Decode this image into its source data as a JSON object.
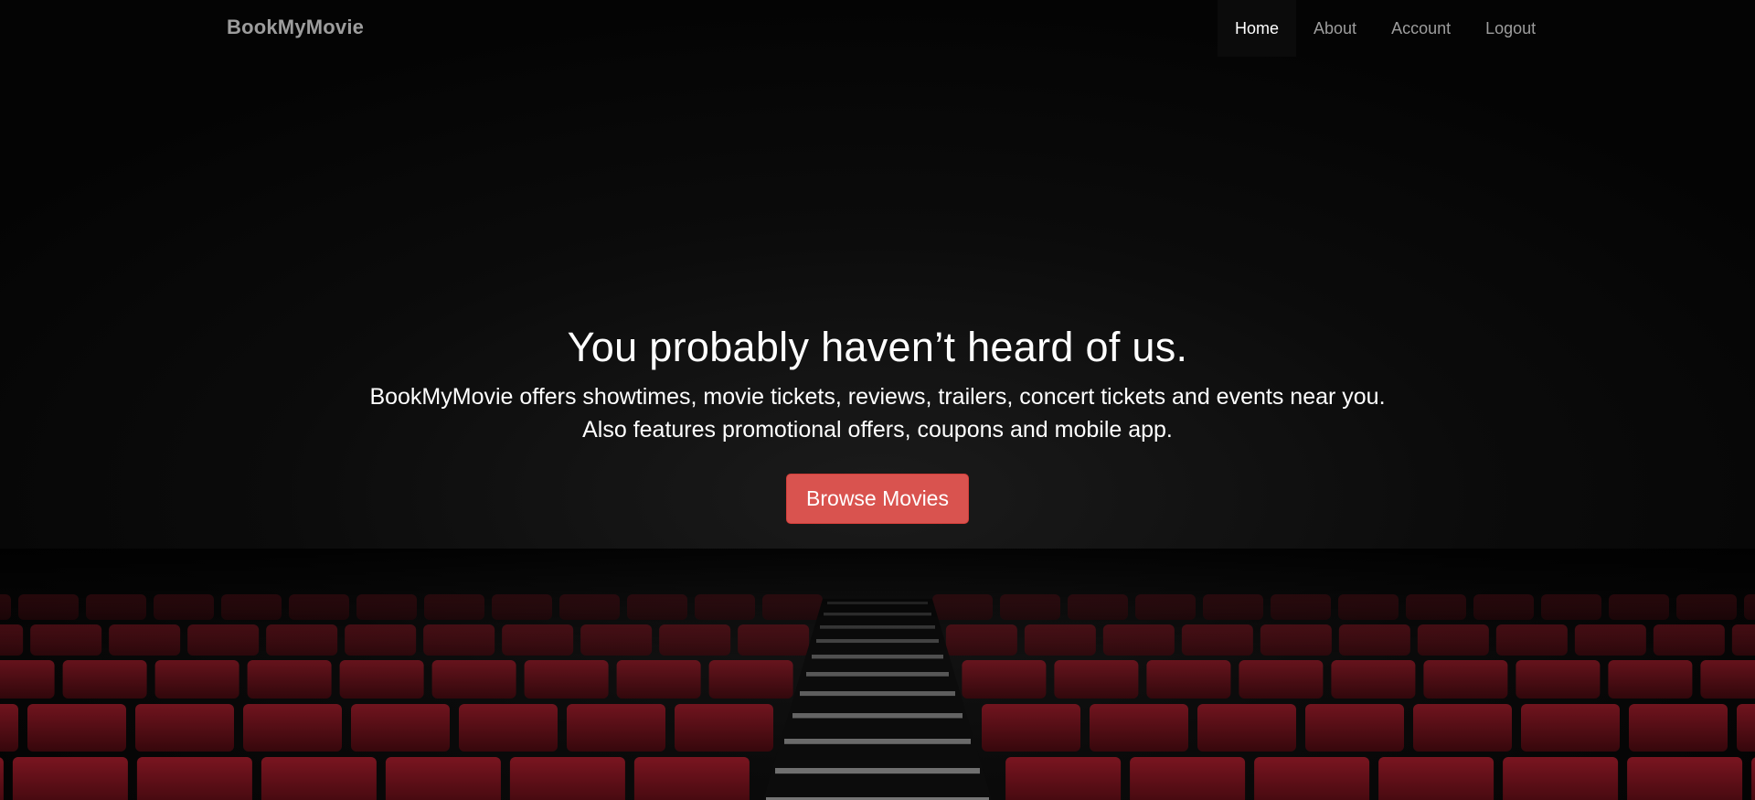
{
  "navbar": {
    "brand": "BookMyMovie",
    "items": [
      {
        "label": "Home",
        "active": true
      },
      {
        "label": "About",
        "active": false
      },
      {
        "label": "Account",
        "active": false
      },
      {
        "label": "Logout",
        "active": false
      }
    ]
  },
  "hero": {
    "heading": "You probably haven’t heard of us.",
    "description": "BookMyMovie offers showtimes, movie tickets, reviews, trailers, concert tickets and events near you. Also features promotional offers, coupons and mobile app.",
    "cta_label": "Browse Movies"
  },
  "colors": {
    "background": "#050505",
    "nav_text": "#9d9d9d",
    "nav_active_text": "#ffffff",
    "cta_background": "#d9534f",
    "seat_color": "#5e0f15"
  },
  "background_image": "dark-movie-theater-red-seats"
}
